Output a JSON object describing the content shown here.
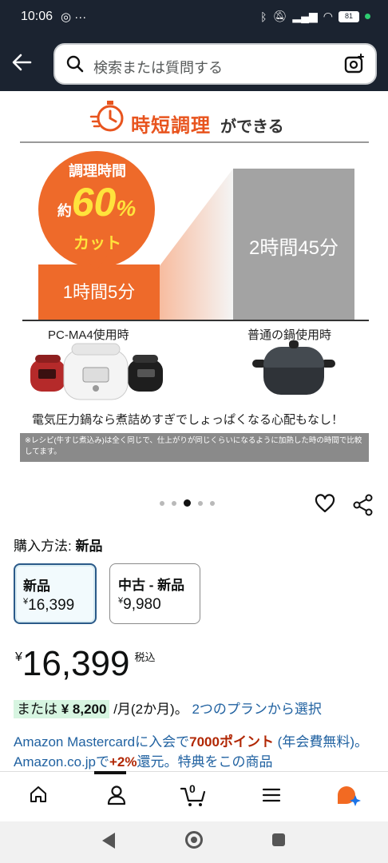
{
  "status_bar": {
    "time": "10:06",
    "left_icons": "◎ ···",
    "battery": "81"
  },
  "search": {
    "placeholder": "検索または質問する"
  },
  "product_image": {
    "headline_accent": "時短調理",
    "headline_rest": "ができる",
    "badge_line1": "調理時間",
    "badge_prefix": "約",
    "badge_number": "60",
    "badge_percent": "%",
    "badge_line3": "カット",
    "bar_short_label": "1時間5分",
    "bar_long_label": "2時間45分",
    "caption_left": "PC-MA4使用時",
    "caption_right": "普通の鍋使用時",
    "note": "電気圧力鍋なら煮詰めすぎでしょっぱくなる心配もなし！",
    "footnote": "※レシピ(牛すじ煮込み)は全く同じで、仕上がりが同じくらいになるように加熱した時の時間で比較してます。"
  },
  "carousel": {
    "total": 5,
    "active": 3
  },
  "purchase": {
    "label": "購入方法:",
    "selected": "新品",
    "options": [
      {
        "title": "新品",
        "currency": "¥",
        "price": "16,399"
      },
      {
        "title": "中古 - 新品",
        "currency": "¥",
        "price": "9,980"
      }
    ]
  },
  "price": {
    "currency": "¥",
    "amount": "16,399",
    "tax": "税込"
  },
  "installment": {
    "prefix": "または",
    "amount": "¥ 8,200",
    "period": "/月(2か月)。",
    "link": "2つのプランから選択"
  },
  "promo": {
    "part1": "Amazon Mastercardに入会で",
    "points": "7000ポイント",
    "part2": " (年会費無料)。 Amazon.co.jpで",
    "percent": "+2%",
    "part3": "還元。特典をこの商品"
  },
  "bottom_nav": {
    "cart_count": "0"
  },
  "colors": {
    "header_bg": "#1b2330",
    "accent_orange": "#ee6a2a",
    "link_blue": "#2162a1",
    "price_red": "#b12704"
  }
}
